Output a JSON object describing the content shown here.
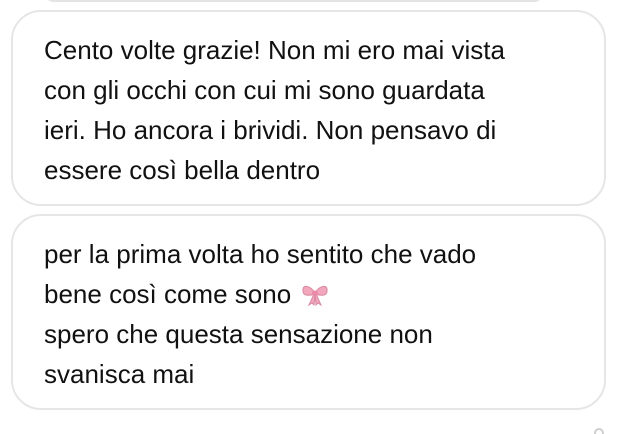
{
  "messages": [
    {
      "lines": [
        "Cento volte grazie! Non mi ero mai vista",
        "con gli occhi con cui mi sono guardata",
        "ieri. Ho ancora i brividi. Non pensavo di",
        "essere così bella dentro"
      ]
    },
    {
      "lines": [
        "per la prima volta ho sentito che vado",
        "bene così come sono",
        "spero che questa sensazione non",
        "svanisca mai"
      ],
      "emoji": "ribbon-bow-icon"
    }
  ],
  "colors": {
    "bubble_border": "#e6e6e6",
    "text": "#111111",
    "bow_pink": "#f2a7bd"
  }
}
